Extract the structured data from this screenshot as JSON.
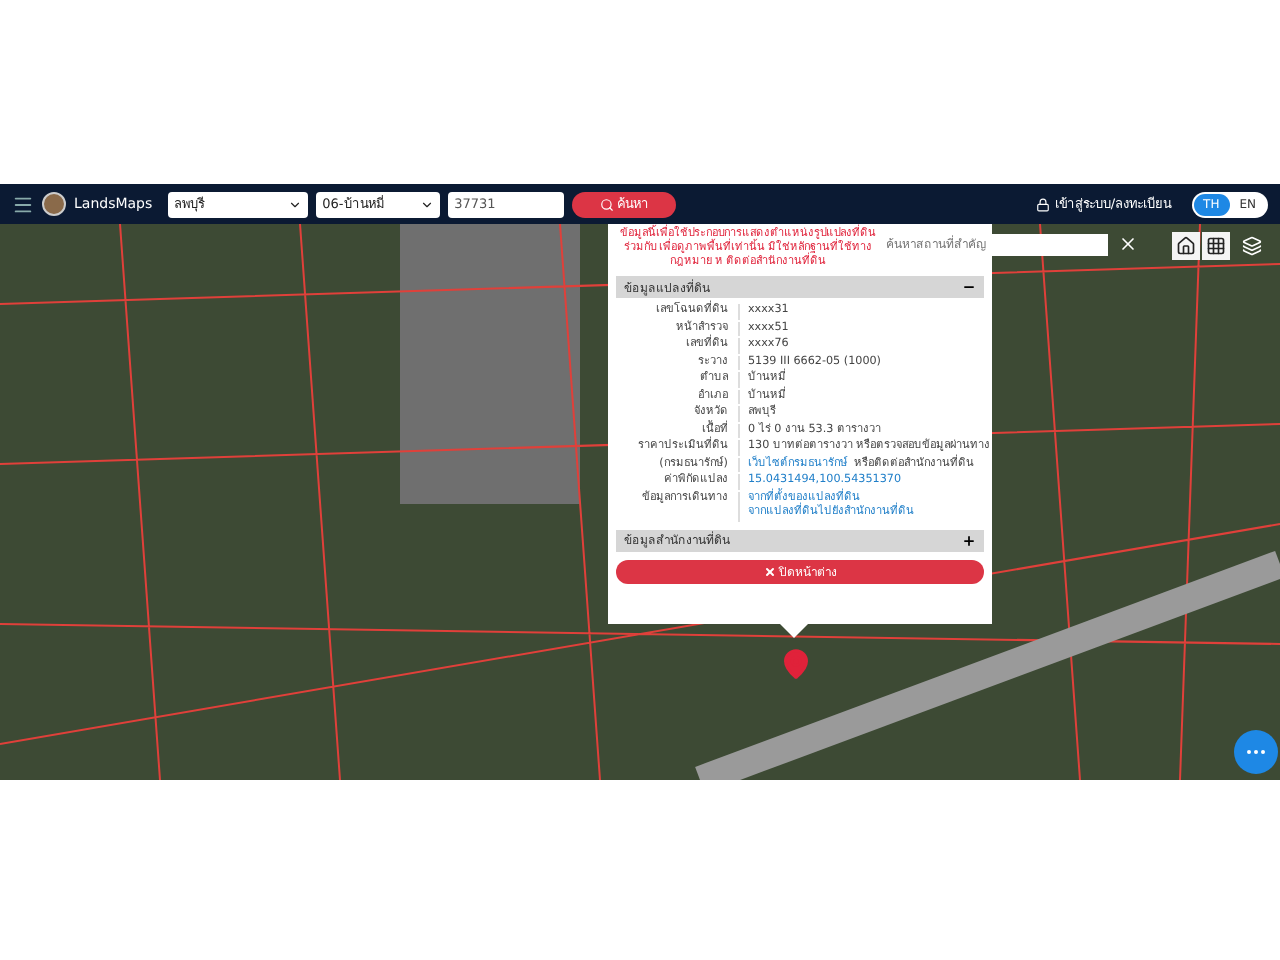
{
  "navbar": {
    "brand": "LandsMaps",
    "province": "ลพบุรี",
    "district": "06-บ้านหมี่",
    "parcel_number": "37731",
    "search_button": "ค้นหา",
    "login": "เข้าสู่ระบบ/ลงทะเบียน",
    "languages": [
      {
        "label": "TH",
        "selected": true
      },
      {
        "label": "EN",
        "selected": false
      }
    ]
  },
  "map": {
    "place_search": {
      "placeholder": "ค้นหาสถานที่สำคัญ"
    }
  },
  "popup": {
    "notice": "ข้อมูลนี้เพื่อใช้ประกอบการแสดงตำแหน่งรูปแปลงที่ดินร่วมกับ เพื่อดูภาพพื้นที่เท่านั้น มิใช่หลักฐานที่ใช้ทางกฎหมาย ห ติดต่อสำนักงานที่ดิน",
    "sections": [
      {
        "title": "ข้อมูลแปลงที่ดิน",
        "expanded": true,
        "rows": [
          {
            "label": "เลขโฉนดที่ดิน",
            "values": [
              {
                "kind": "text",
                "text": "xxxx31"
              }
            ]
          },
          {
            "label": "หน้าสำรวจ",
            "values": [
              {
                "kind": "text",
                "text": "xxxx51"
              }
            ]
          },
          {
            "label": "เลขที่ดิน",
            "values": [
              {
                "kind": "text",
                "text": "xxxx76"
              }
            ]
          },
          {
            "label": "ระวาง",
            "values": [
              {
                "kind": "text",
                "text": "5139 III 6662-05 (1000)"
              }
            ]
          },
          {
            "label": "ตำบล",
            "values": [
              {
                "kind": "text",
                "text": "บ้านหมี่"
              }
            ]
          },
          {
            "label": "อำเภอ",
            "values": [
              {
                "kind": "text",
                "text": "บ้านหมี่"
              }
            ]
          },
          {
            "label": "จังหวัด",
            "values": [
              {
                "kind": "text",
                "text": "ลพบุรี"
              }
            ]
          },
          {
            "label": "เนื้อที่",
            "values": [
              {
                "kind": "text",
                "text": "0 ไร่ 0 งาน 53.3 ตารางวา"
              }
            ]
          },
          {
            "label": "ราคาประเมินที่ดิน",
            "values": [
              {
                "kind": "text",
                "text": "130 บาทต่อตารางวา หรือตรวจสอบข้อมูลผ่านทาง"
              }
            ]
          },
          {
            "label": "(กรมธนารักษ์)",
            "values": [
              {
                "kind": "link",
                "text": "เว็บไซต์กรมธนารักษ์"
              },
              {
                "kind": "text",
                "text": "หรือติดต่อสำนักงานที่ดิน"
              }
            ]
          },
          {
            "label": "ค่าพิกัดแปลง",
            "values": [
              {
                "kind": "link",
                "text": "15.0431494,100.54351370"
              }
            ]
          },
          {
            "label": "ข้อมูลการเดินทาง",
            "values": [
              {
                "kind": "link",
                "text": "จากที่ตั้งของแปลงที่ดิน"
              },
              {
                "kind": "link",
                "text": "จากแปลงที่ดินไปยังสำนักงานที่ดิน"
              }
            ]
          }
        ]
      },
      {
        "title": "ข้อมูลสำนักงานที่ดิน",
        "expanded": false
      }
    ],
    "close_button": "ปิดหน้าต่าง"
  }
}
